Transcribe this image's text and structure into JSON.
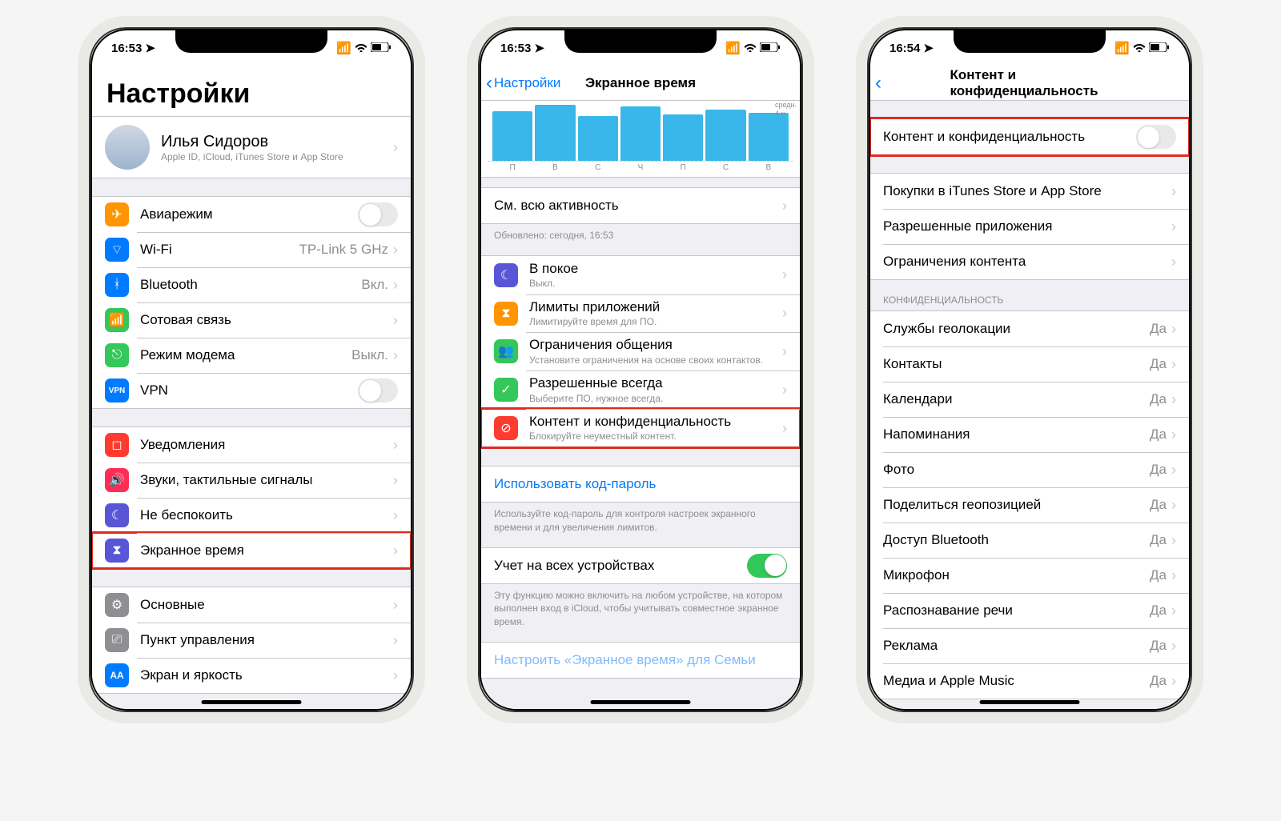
{
  "phone1": {
    "time": "16:53",
    "title": "Настройки",
    "profile": {
      "name": "Илья Сидоров",
      "sub": "Apple ID, iCloud, iTunes Store и App Store"
    },
    "group1": [
      {
        "icon": "airplane",
        "color": "#ff9500",
        "title": "Авиарежим",
        "toggle": false
      },
      {
        "icon": "wifi",
        "color": "#007aff",
        "title": "Wi-Fi",
        "value": "TP-Link 5 GHz"
      },
      {
        "icon": "bluetooth",
        "color": "#007aff",
        "title": "Bluetooth",
        "value": "Вкл."
      },
      {
        "icon": "cell",
        "color": "#34c759",
        "title": "Сотовая связь"
      },
      {
        "icon": "hotspot",
        "color": "#34c759",
        "title": "Режим модема",
        "value": "Выкл."
      },
      {
        "icon": "vpn",
        "color": "#007aff",
        "title": "VPN",
        "toggle": false
      }
    ],
    "group2": [
      {
        "icon": "bell",
        "color": "#ff3b30",
        "title": "Уведомления"
      },
      {
        "icon": "sound",
        "color": "#ff2d55",
        "title": "Звуки, тактильные сигналы"
      },
      {
        "icon": "moon",
        "color": "#5856d6",
        "title": "Не беспокоить"
      },
      {
        "icon": "hourglass",
        "color": "#5856d6",
        "title": "Экранное время",
        "hl": true
      }
    ],
    "group3": [
      {
        "icon": "gear",
        "color": "#8e8e93",
        "title": "Основные"
      },
      {
        "icon": "switches",
        "color": "#8e8e93",
        "title": "Пункт управления"
      },
      {
        "icon": "aa",
        "color": "#007aff",
        "title": "Экран и яркость"
      }
    ]
  },
  "phone2": {
    "time": "16:53",
    "back": "Настройки",
    "title": "Экранное время",
    "chart": {
      "labels": [
        "П",
        "В",
        "С",
        "Ч",
        "П",
        "С",
        "В"
      ],
      "heights": [
        62,
        70,
        56,
        68,
        58,
        64,
        60
      ],
      "side1": "средн.",
      "side2": "4 ч"
    },
    "activity": {
      "title": "См. всю активность",
      "updated": "Обновлено: сегодня, 16:53"
    },
    "features": [
      {
        "icon": "moon",
        "color": "#5856d6",
        "title": "В покое",
        "sub": "Выкл."
      },
      {
        "icon": "hourglass",
        "color": "#ff9500",
        "title": "Лимиты приложений",
        "sub": "Лимитируйте время для ПО."
      },
      {
        "icon": "people",
        "color": "#34c759",
        "title": "Ограничения общения",
        "sub": "Установите ограничения на основе своих контактов."
      },
      {
        "icon": "check",
        "color": "#34c759",
        "title": "Разрешенные всегда",
        "sub": "Выберите ПО, нужное всегда."
      },
      {
        "icon": "nosign",
        "color": "#ff3b30",
        "title": "Контент и конфиденциальность",
        "sub": "Блокируйте неуместный контент.",
        "hl": true
      }
    ],
    "passcode": {
      "title": "Использовать код-пароль",
      "footer": "Используйте код-пароль для контроля настроек экранного времени и для увеличения лимитов."
    },
    "devices": {
      "title": "Учет на всех устройствах",
      "footer": "Эту функцию можно включить на любом устройстве, на котором выполнен вход в iCloud, чтобы учитывать совместное экранное время."
    },
    "family": "Настроить «Экранное время» для Семьи"
  },
  "phone3": {
    "time": "16:54",
    "title": "Контент и конфиденциальность",
    "main_toggle": "Контент и конфиденциальность",
    "group1": [
      {
        "title": "Покупки в iTunes Store и App Store"
      },
      {
        "title": "Разрешенные приложения"
      },
      {
        "title": "Ограничения контента"
      }
    ],
    "privacy_header": "КОНФИДЕНЦИАЛЬНОСТЬ",
    "privacy": [
      {
        "title": "Службы геолокации",
        "value": "Да"
      },
      {
        "title": "Контакты",
        "value": "Да"
      },
      {
        "title": "Календари",
        "value": "Да"
      },
      {
        "title": "Напоминания",
        "value": "Да"
      },
      {
        "title": "Фото",
        "value": "Да"
      },
      {
        "title": "Поделиться геопозицией",
        "value": "Да"
      },
      {
        "title": "Доступ Bluetooth",
        "value": "Да"
      },
      {
        "title": "Микрофон",
        "value": "Да"
      },
      {
        "title": "Распознавание речи",
        "value": "Да"
      },
      {
        "title": "Реклама",
        "value": "Да"
      },
      {
        "title": "Медиа и Apple Music",
        "value": "Да"
      }
    ]
  },
  "chart_data": {
    "type": "bar",
    "categories": [
      "П",
      "В",
      "С",
      "Ч",
      "П",
      "С",
      "В"
    ],
    "values": [
      62,
      70,
      56,
      68,
      58,
      64,
      60
    ],
    "title": "Экранное время",
    "annotations": [
      "средн.",
      "4 ч"
    ]
  }
}
